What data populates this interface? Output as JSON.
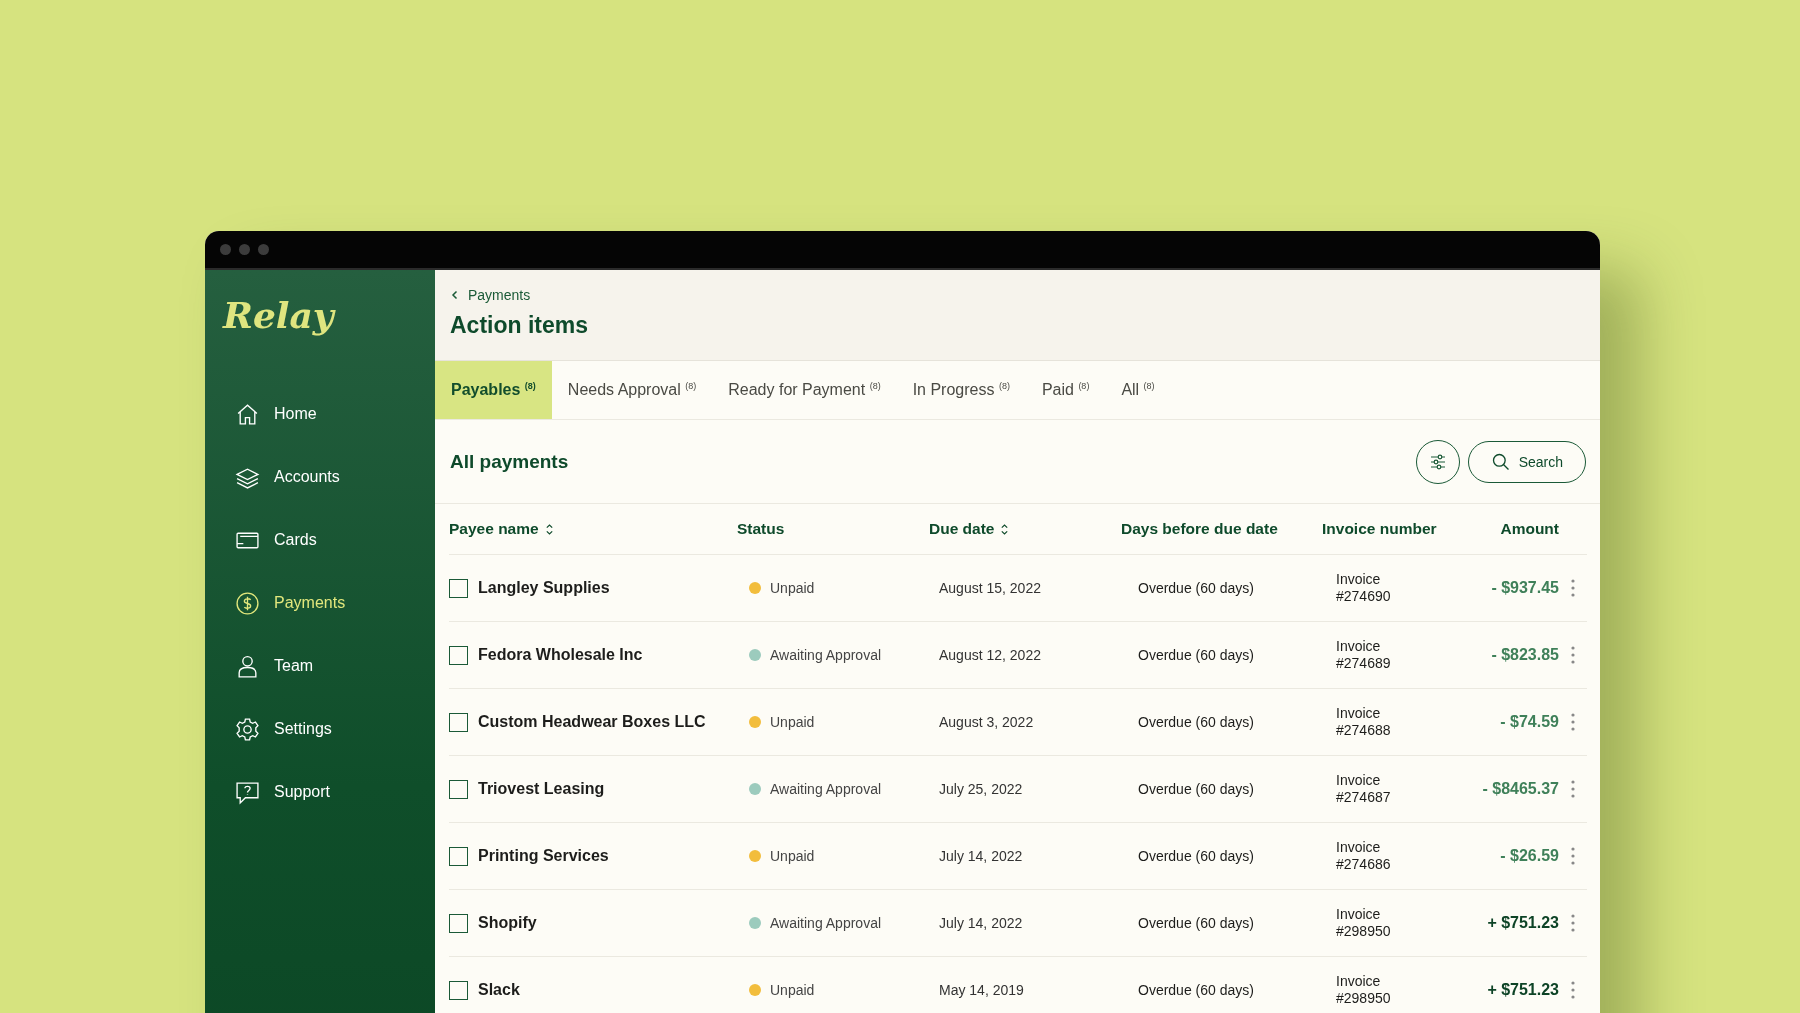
{
  "sidebar": {
    "logo": "Relay",
    "items": [
      {
        "label": "Home",
        "selected": false
      },
      {
        "label": "Accounts",
        "selected": false
      },
      {
        "label": "Cards",
        "selected": false
      },
      {
        "label": "Payments",
        "selected": true
      },
      {
        "label": "Team",
        "selected": false
      },
      {
        "label": "Settings",
        "selected": false
      },
      {
        "label": "Support",
        "selected": false
      }
    ]
  },
  "breadcrumb": "Payments",
  "title": "Action items",
  "tabs": [
    {
      "label": "Payables",
      "count": "(8)",
      "selected": true
    },
    {
      "label": "Needs Approval",
      "count": "(8)",
      "selected": false
    },
    {
      "label": "Ready for Payment",
      "count": "(8)",
      "selected": false
    },
    {
      "label": "In Progress",
      "count": "(8)",
      "selected": false
    },
    {
      "label": "Paid",
      "count": "(8)",
      "selected": false
    },
    {
      "label": "All",
      "count": "(8)",
      "selected": false
    }
  ],
  "section_title": "All payments",
  "search": {
    "label": "Search"
  },
  "table": {
    "columns": [
      {
        "label": "Payee name",
        "sortable": true
      },
      {
        "label": "Status",
        "sortable": false
      },
      {
        "label": "Due date",
        "sortable": true
      },
      {
        "label": "Days before due date",
        "sortable": false
      },
      {
        "label": "Invoice number",
        "sortable": false
      },
      {
        "label": "Amount",
        "sortable": false
      }
    ],
    "rows": [
      {
        "checked": false,
        "payee": "Langley Supplies",
        "status": "Unpaid",
        "color": "#f2bd3c",
        "due": "August 15, 2022",
        "days": "Overdue (60 days)",
        "invoice": [
          "Invoice",
          "#274690"
        ],
        "amount": {
          "text": "- $937.45",
          "color": "#3f8059"
        }
      },
      {
        "checked": false,
        "payee": "Fedora Wholesale Inc",
        "status": "Awaiting Approval",
        "color": "#9ccbbd",
        "due": "August 12, 2022",
        "days": "Overdue (60 days)",
        "invoice": [
          "Invoice",
          "#274689"
        ],
        "amount": {
          "text": "- $823.85",
          "color": "#3f8059"
        }
      },
      {
        "checked": false,
        "payee": "Custom Headwear Boxes LLC",
        "status": "Unpaid",
        "color": "#f2bd3c",
        "due": "August 3, 2022",
        "days": "Overdue (60 days)",
        "invoice": [
          "Invoice",
          "#274688"
        ],
        "amount": {
          "text": "- $74.59",
          "color": "#3f8059"
        }
      },
      {
        "checked": false,
        "payee": "Triovest Leasing",
        "status": "Awaiting Approval",
        "color": "#9ccbbd",
        "due": "July 25, 2022",
        "days": "Overdue (60 days)",
        "invoice": [
          "Invoice",
          "#274687"
        ],
        "amount": {
          "text": "- $8465.37",
          "color": "#3f8059"
        }
      },
      {
        "checked": false,
        "payee": "Printing Services",
        "status": "Unpaid",
        "color": "#f2bd3c",
        "due": "July 14, 2022",
        "days": "Overdue (60 days)",
        "invoice": [
          "Invoice",
          "#274686"
        ],
        "amount": {
          "text": "- $26.59",
          "color": "#3f8059"
        }
      },
      {
        "checked": false,
        "payee": "Shopify",
        "status": "Awaiting Approval",
        "color": "#9ccbbd",
        "due": "July 14, 2022",
        "days": "Overdue (60 days)",
        "invoice": [
          "Invoice",
          "#298950"
        ],
        "amount": {
          "text": "+ $751.23",
          "color": "#0d4326"
        }
      },
      {
        "checked": false,
        "payee": "Slack",
        "status": "Unpaid",
        "color": "#f2bd3c",
        "due": "May 14, 2019",
        "days": "Overdue (60 days)",
        "invoice": [
          "Invoice",
          "#298950"
        ],
        "amount": {
          "text": "+ $751.23",
          "color": "#0d4326"
        }
      }
    ]
  }
}
